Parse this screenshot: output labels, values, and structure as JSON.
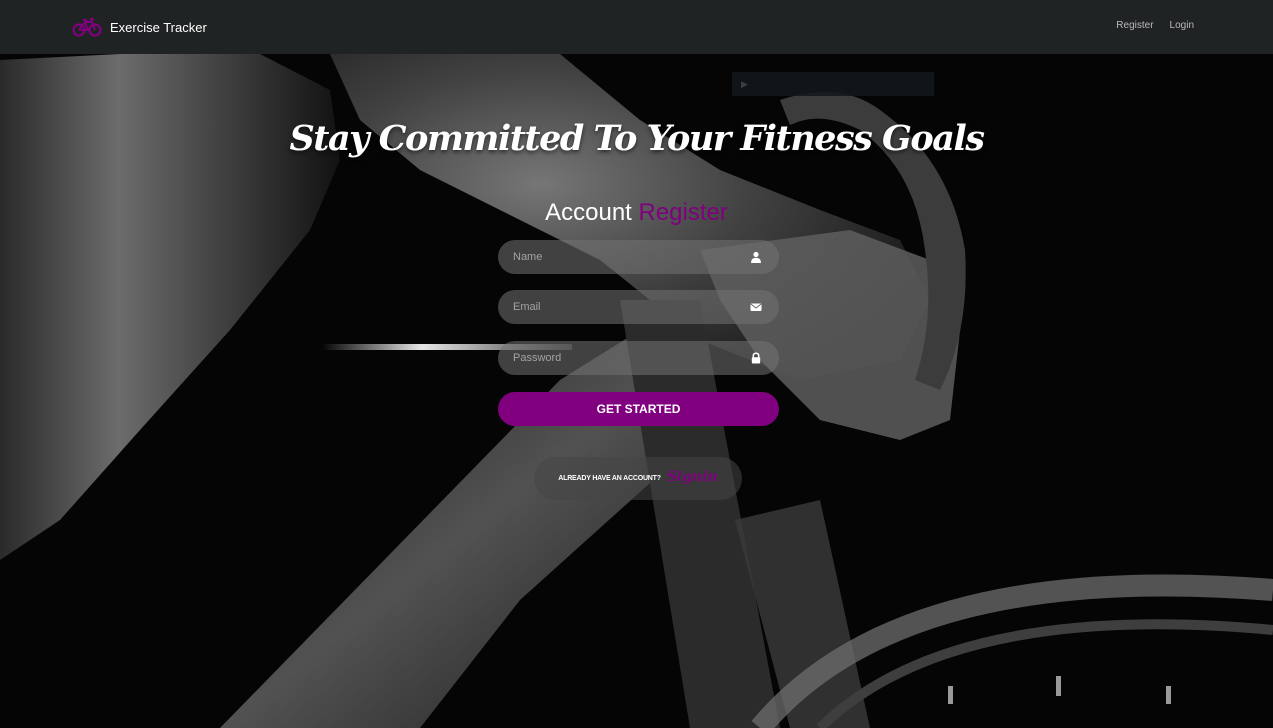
{
  "brand": {
    "name": "Exercise Tracker",
    "icon": "bicycle-icon"
  },
  "nav": {
    "register_label": "Register",
    "login_label": "Login"
  },
  "hero": {
    "headline": "Stay Committed To Your Fitness Goals"
  },
  "form": {
    "title_prefix": "Account",
    "title_accent": "Register",
    "name_placeholder": "Name",
    "email_placeholder": "Email",
    "password_placeholder": "Password",
    "name_icon": "user-icon",
    "email_icon": "envelope-icon",
    "password_icon": "lock-icon",
    "submit_label": "GET STARTED"
  },
  "signin": {
    "prompt": "ALREADY HAVE AN ACCOUNT?",
    "link_label": "Signin"
  },
  "colors": {
    "accent": "#800080",
    "navbar": "#202324",
    "field": "#737373"
  }
}
